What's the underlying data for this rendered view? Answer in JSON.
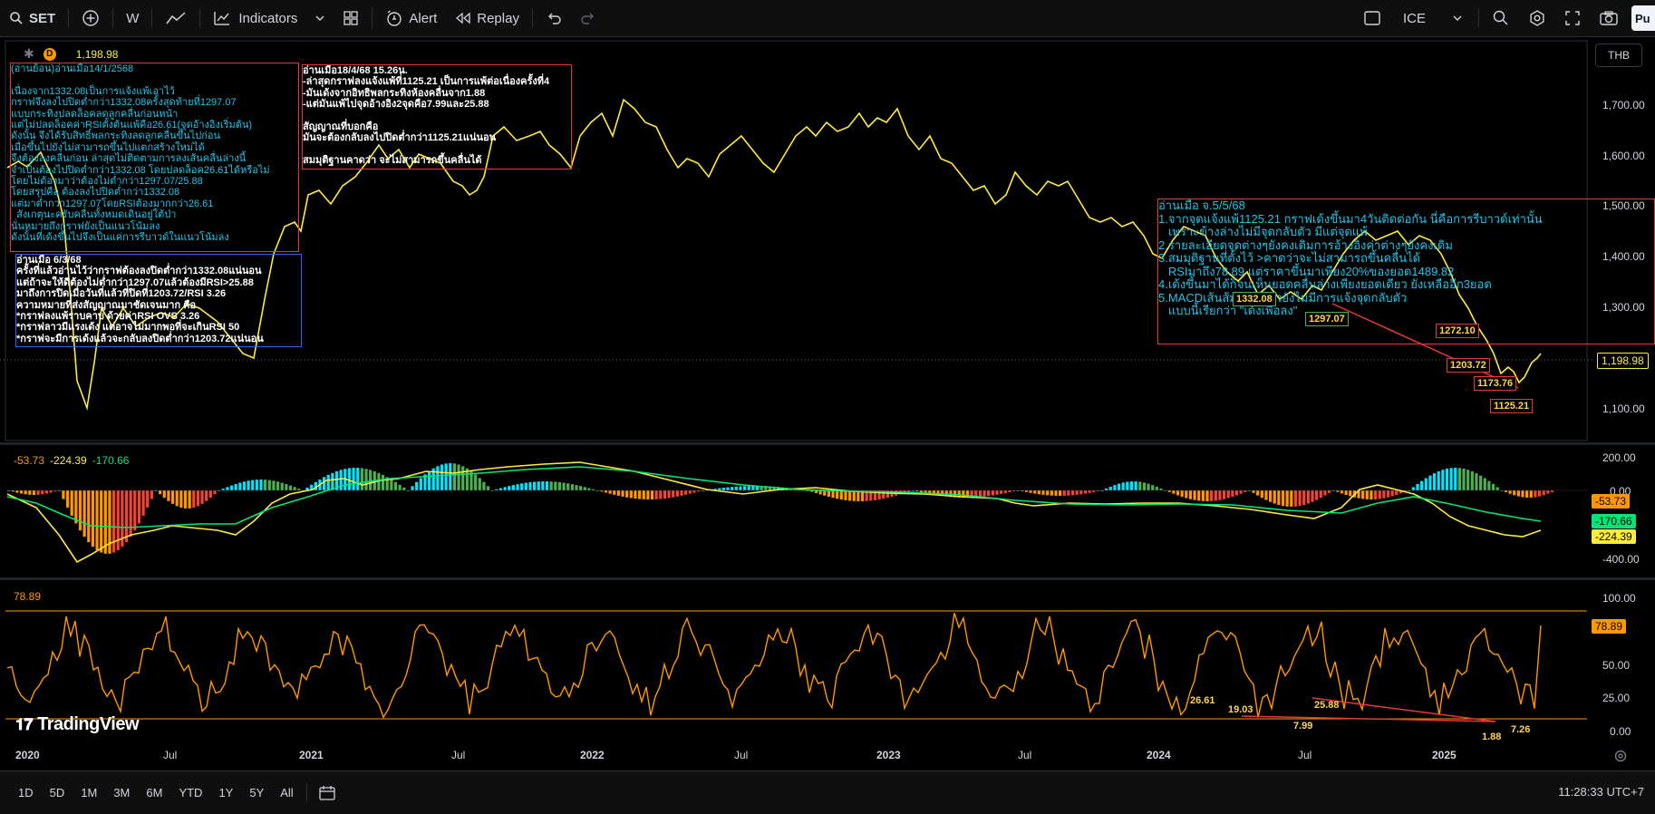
{
  "toolbar": {
    "symbol": "SET",
    "interval": "W",
    "indicators_label": "Indicators",
    "alert_label": "Alert",
    "replay_label": "Replay",
    "exchange": "ICE",
    "publish_label": "Pu"
  },
  "legend": {
    "interval_badge": "D",
    "price": "1,198.98",
    "macd_values": [
      "-53.73",
      "-224.39",
      "-170.66"
    ],
    "rsi_value": "78.89"
  },
  "currency": "THB",
  "price_axis": [
    "1,700.00",
    "1,600.00",
    "1,500.00",
    "1,400.00",
    "1,300.00",
    "1,200.00",
    "1,100.00"
  ],
  "macd_axis": [
    "200.00",
    "0.00",
    "-400.00"
  ],
  "rsi_axis": [
    "100.00",
    "50.00",
    "25.00",
    "0.00"
  ],
  "price_tags": {
    "last_price": "1,198.98",
    "macd_hist": "-53.73",
    "macd_signal": "-170.66",
    "macd_line": "-224.39",
    "rsi": "78.89"
  },
  "time_axis": [
    {
      "label": "2020",
      "year": true
    },
    {
      "label": "Jul",
      "year": false
    },
    {
      "label": "2021",
      "year": true
    },
    {
      "label": "Jul",
      "year": false
    },
    {
      "label": "2022",
      "year": true
    },
    {
      "label": "Jul",
      "year": false
    },
    {
      "label": "2023",
      "year": true
    },
    {
      "label": "Jul",
      "year": false
    },
    {
      "label": "2024",
      "year": true
    },
    {
      "label": "Jul",
      "year": false
    },
    {
      "label": "2025",
      "year": true
    }
  ],
  "annotations": {
    "box_a": "(อ่านย้อน)อ่านเมื่อ14/1/2568\n\nเนื่องจาก1332.08เป็นการแจ้งแพ้เอาไว้\nกราฟจึงลงไปปิดต่ำกว่า1332.08ครั้งสุดท้ายที่1297.07\nแบบกระทิงปลดล็อคลดลูกคลื่นก่อนหน้า\nแต่ไม่ปลดล็อคค่าRSIตั้งต้นแพ้คือ26.61(จุดอ้างอิงเริ่มต้น)\nดังนั้น จึงได้รับสิทธิ์พลกระทิงลดลูกคลื่นขึ้นไปก่อน\nเมื่อขึ้นไปยังไม่สามารถขึ้นไปแตกสร้างใหม่ได้\nจึงต้องลงคลื่นก่อน ล่าสุดไม่ติดตามการลงเส้นคลื่นล่างนี้\nจำเป็นต้องไปปิดต่ำกว่า1332.08 โดยปลดล็อค26.61ได้หรือไม่\nโดยไม่ต้องมาว่าต้องไม่ต่ำกว่า1297.07/25.88\nโดยสรุปคือ ต้องลงไปปิดต่ำกว่า1332.08\nแต่มาต่ำกว่า1297.07โดยRSIต้องมากกว่า26.61\n  สังเกตุนะครับคลื่นทั้งหมดเดินอยู่ใต้ป่า\nนั่นหมายถึงกราฟยังเป็นแนวโน้มลง\nดังนั้นที่เด้งขึ้นไปจึงเป็นแค่การรีบาวด์ในแนวโน้มลง",
    "box_b": "อ่านเมื่อ18/4/68 15.26น.\n-ล่าสุดกราฟลงแจ้งแพ้ที่1125.21 เป็นการแพ้ต่อเนื่องครั้งที่4\n-มันเด้งจากอิทธิพลกระทิงห้องคลื่นจาก1.88\n-แต่มันแพ้ไปจุดอ้างอิง2จุดคือ7.99และ25.88\n\nสัญญาณที่บอกคือ\nมันจะต้องกลับลงไปปิดต่ำกว่า1125.21แน่นอน\n\nสมมุติฐานคาดว่า จะไม่สามารถขึ้นคลื่นได้",
    "box_c": "อ่านเมื่อ 6/3/68\nครั้งที่แล้วอ่านไว้ว่ากราฟต้องลงปิดต่ำกว่า1332.08แน่นอน\nแต่ถ้าจะให้ดีต้องไม่ต่ำกว่า1297.07แล้วต้องมีRSI>25.88\nมาถึงการปิดเมื่อวันที่แล้วที่ปิดที่1203.72/RSI 3.26\nความหมายที่ส่งสัญญาณมาชัดเจนมาก คือ\n*กราฟลงแพ้ราบคาบ ด้วยค่าRSI OVS 3.26\n*กราฟลาวมีแรงเด้ง แต่อาจไม่มากพอที่จะเกินRSI 50\n*กราฟจะมีการเด้งแล้วจะกลับลงปิดต่ำกว่า1203.72แน่นอน",
    "box_d": "อ่านเมื่อ จ.5/5/68\n1.จากจุดแจ้งแพ้1125.21 กราฟเด้งขึ้นมา4วันติดต่อกัน นี่คือการรีบาวด์เท่านั้น\n   เพราะข้างล่างไม่มีจุดกลับตัว มีแต่จุดแพ้\n2.รายละเอียดจุดต่างๆยังคงเดิมการอ้างอิงค่าต่างๆยังคงเดิม\n3.สมมุติฐานที่ตั้งไว้ >คาดว่าจะไม่สามารถขึ้นคลื่นได้\n   RSIมาถึง78.89 แต่ราคาขึ้นมาเพียง20%ของยอด1489.82\n4.เด้งขึ้นมาได้ก็จนเห็นยอดคลื่นล่างเพียงยอดเดียว ยังเหลืออีก3ยอด\n5.MACDเส้นส้มเส้นเขียวยังไม่มีการแจ้งจุดกลับตัว\n   แบบนี้เรียกว่า \"เด้งเพื่อลง\""
  },
  "price_labels": {
    "p1": "1332.08",
    "p2": "1297.07",
    "p3": "1272.10",
    "p4": "1203.72",
    "p5": "1173.76",
    "p6": "1125.21"
  },
  "rsi_labels": {
    "r1": "26.61",
    "r2": "19.03",
    "r3": "25.88",
    "r4": "7.99",
    "r5": "1.88",
    "r6": "7.26"
  },
  "bottom": {
    "ranges": [
      "1D",
      "5D",
      "1M",
      "3M",
      "6M",
      "YTD",
      "1Y",
      "5Y",
      "All"
    ],
    "clock": "11:28:33 UTC+7"
  },
  "brand": "TradingView",
  "colors": {
    "price_line": "#ffeb3b",
    "macd_line": "#ffeb3b",
    "signal_line": "#00e676",
    "rsi_line": "#ff9800",
    "rsi_bands": "#ff9800",
    "hist_pos_strong": "#00e5ff",
    "hist_pos_weak": "#4caf50",
    "hist_neg_strong": "#ff9800",
    "hist_neg_weak": "#f44336"
  }
}
